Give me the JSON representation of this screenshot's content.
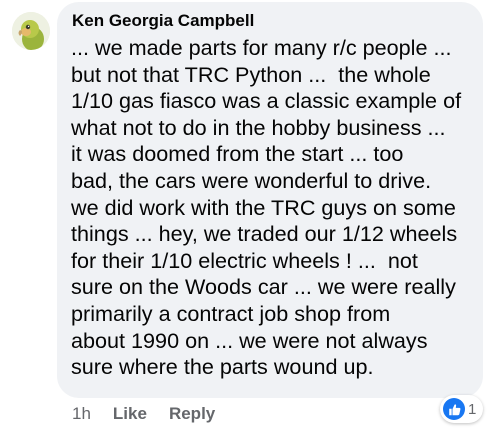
{
  "comment": {
    "author": "Ken Georgia Campbell",
    "body_lines": [
      "... we made parts for many r/c people ...",
      "but not that TRC Python ...  the whole",
      "1/10 gas fiasco was a classic example of",
      "what not to do in the hobby business ...",
      "it was doomed from the start ... too",
      "bad, the cars were wonderful to drive.",
      "we did work with the TRC guys on some",
      "things ... hey, we traded our 1/12 wheels",
      "for their 1/10 electric wheels ! ...  not",
      "sure on the Woods car ... we were really",
      "primarily a contract job shop from",
      "about 1990 on ... we were not always",
      "sure where the parts wound up."
    ],
    "time": "1h",
    "like_label": "Like",
    "reply_label": "Reply",
    "reaction_count": "1",
    "reaction_icon": "thumbs-up-icon"
  },
  "colors": {
    "bubble": "#f0f2f5",
    "text": "#050505",
    "meta": "#65676b",
    "like_badge": "#1877f2"
  }
}
